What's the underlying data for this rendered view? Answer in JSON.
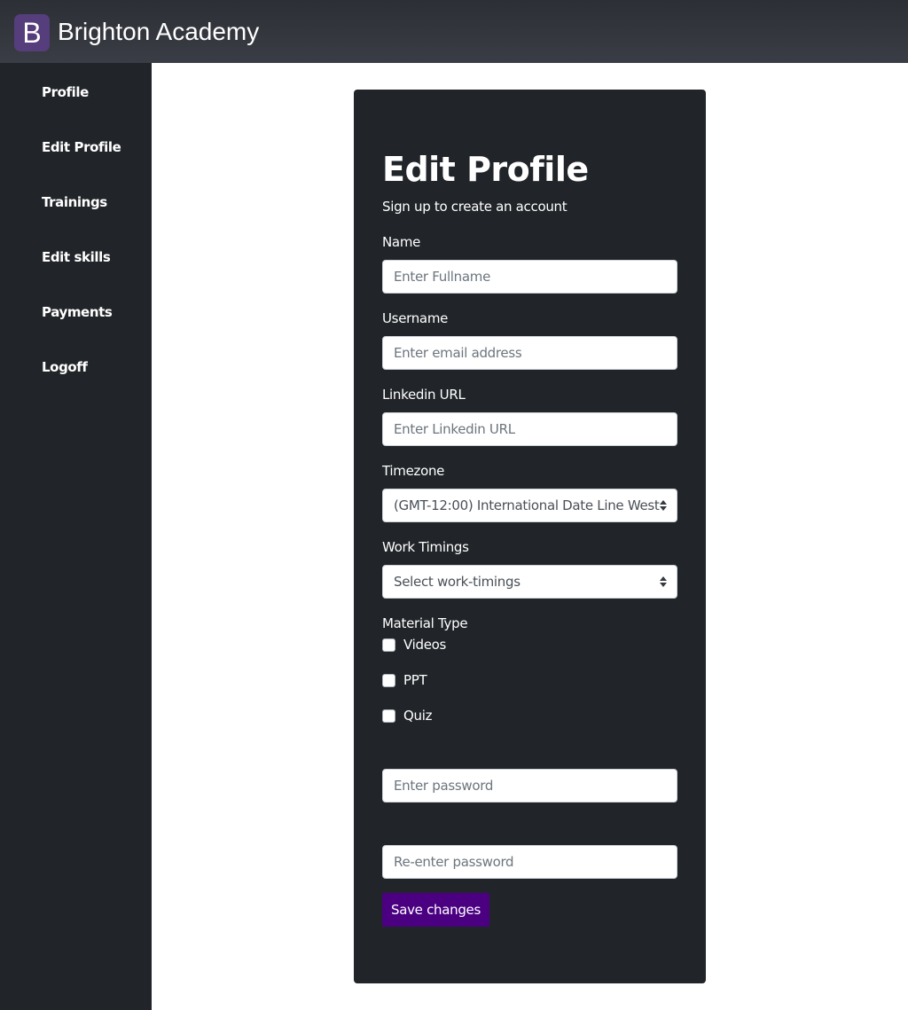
{
  "brand": {
    "logo_letter": "B",
    "name": "Brighton Academy",
    "logo_color": "#563d7c"
  },
  "sidebar": {
    "items": [
      {
        "label": "Profile"
      },
      {
        "label": "Edit Profile"
      },
      {
        "label": "Trainings"
      },
      {
        "label": "Edit skills"
      },
      {
        "label": "Payments"
      },
      {
        "label": "Logoff"
      }
    ]
  },
  "form": {
    "title": "Edit Profile",
    "subtitle": "Sign up to create an account",
    "name": {
      "label": "Name",
      "placeholder": "Enter Fullname",
      "value": ""
    },
    "username": {
      "label": "Username",
      "placeholder": "Enter email address",
      "value": ""
    },
    "linkedin": {
      "label": "Linkedin URL",
      "placeholder": "Enter Linkedin URL",
      "value": ""
    },
    "timezone": {
      "label": "Timezone",
      "selected": "(GMT-12:00) International Date Line West"
    },
    "work_timings": {
      "label": "Work Timings",
      "selected": "Select work-timings"
    },
    "material_type": {
      "label": "Material Type",
      "options": [
        {
          "label": "Videos",
          "checked": false
        },
        {
          "label": "PPT",
          "checked": false
        },
        {
          "label": "Quiz",
          "checked": false
        }
      ]
    },
    "password": {
      "placeholder": "Enter password",
      "value": ""
    },
    "confirm_password": {
      "placeholder": "Re-enter password",
      "value": ""
    },
    "save_label": "Save changes",
    "save_color": "#4b0082"
  },
  "colors": {
    "sidebar_bg": "#212529",
    "card_bg": "#212529",
    "topbar_bg": "#343a40"
  }
}
